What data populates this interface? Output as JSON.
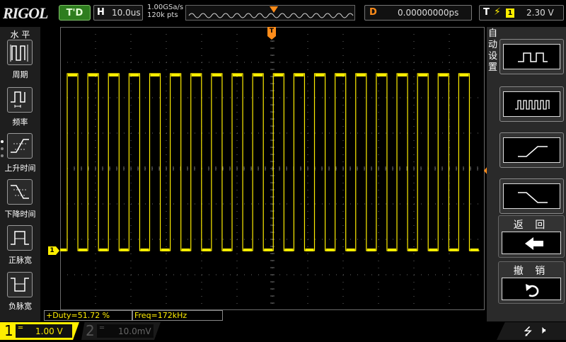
{
  "brand": {
    "logo_text": "RIGOL"
  },
  "status": {
    "trigger_state": "T'D"
  },
  "timebase": {
    "label": "H",
    "value": "10.0us"
  },
  "acquisition": {
    "sample_rate": "1.00GSa/s",
    "memory_depth": "120k pts"
  },
  "delay": {
    "label": "D",
    "value": "0.00000000ps"
  },
  "trigger": {
    "label": "T",
    "source": "1",
    "level": "2.30 V"
  },
  "left_menu": {
    "title": "水 平",
    "items": [
      {
        "label": "周期",
        "icon": "period-icon"
      },
      {
        "label": "频率",
        "icon": "frequency-icon"
      },
      {
        "label": "上升时间",
        "icon": "rise-time-icon"
      },
      {
        "label": "下降时间",
        "icon": "fall-time-icon"
      },
      {
        "label": "正脉宽",
        "icon": "positive-width-icon"
      },
      {
        "label": "负脉宽",
        "icon": "negative-width-icon"
      }
    ]
  },
  "right_menu": {
    "auto_label": "自动设置",
    "buttons": [
      {
        "icon": "single-period-icon"
      },
      {
        "icon": "multi-period-icon"
      },
      {
        "icon": "rising-edge-icon"
      },
      {
        "icon": "falling-edge-icon"
      }
    ],
    "back_label": "返 回",
    "undo_label": "撤 销"
  },
  "markers": {
    "trigger_top": "T",
    "trigger_level": "T",
    "channel_ground": "1"
  },
  "measurements": {
    "duty": "+Duty=51.72 %",
    "freq": "Freq=172kHz"
  },
  "channels": [
    {
      "number": "1",
      "coupling": "DC",
      "scale": "1.00 V",
      "active": true
    },
    {
      "number": "2",
      "coupling": "DC",
      "scale": "10.0mV",
      "active": false
    }
  ],
  "colors": {
    "ch1": "#ffee00",
    "accent_orange": "#ff8c1a",
    "grid": "#6a6a6a",
    "trig_green": "#2e7d1e"
  },
  "waveform": {
    "type": "square",
    "cycles_visible": 20,
    "duty_percent": 51.72,
    "frequency": "172kHz"
  }
}
